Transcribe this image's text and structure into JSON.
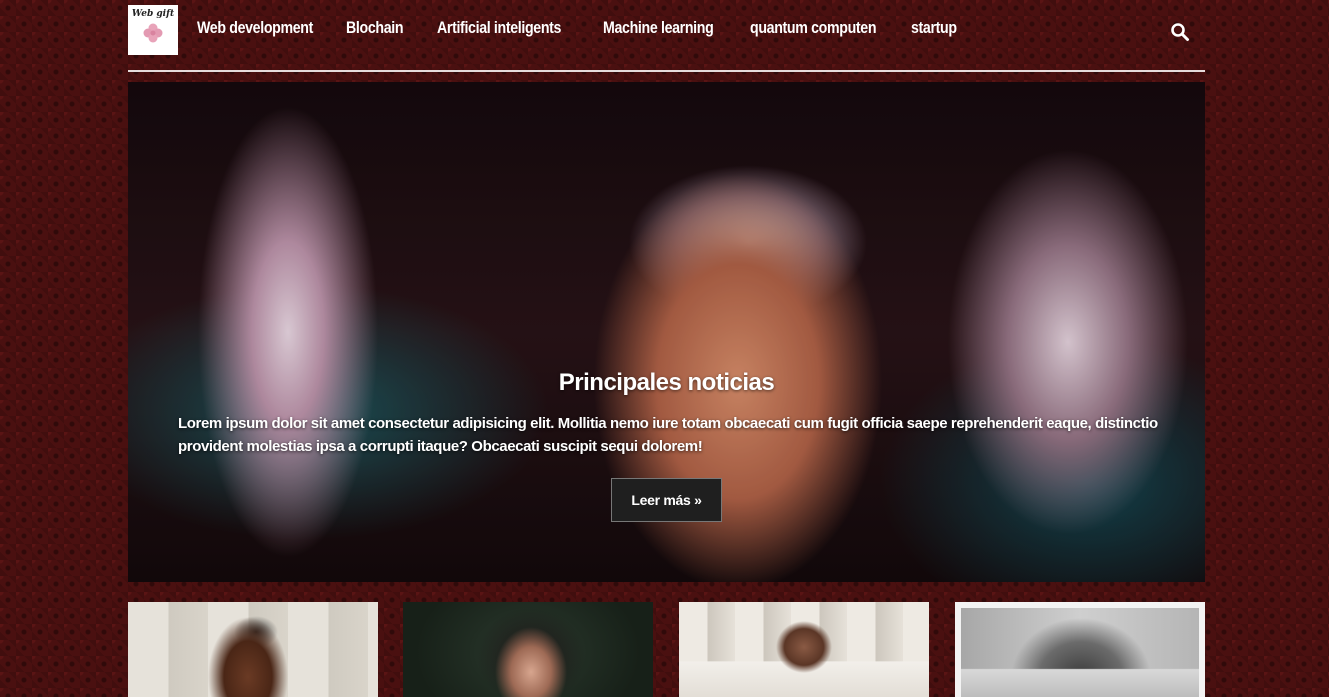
{
  "logo": {
    "text": "Web gift",
    "icon": "flower-logo-icon"
  },
  "nav": {
    "items": [
      {
        "label": "Web development"
      },
      {
        "label": "Blochain"
      },
      {
        "label": "Artificial inteligents"
      },
      {
        "label": "Machine learning"
      },
      {
        "label": "quantum computen"
      },
      {
        "label": "startup"
      }
    ],
    "search_icon": "search-icon"
  },
  "hero": {
    "title": "Principales noticias",
    "text": "Lorem ipsum dolor sit amet consectetur adipisicing elit. Mollitia nemo iure totam obcaecati cum fugit officia saepe reprehenderit eaque, distinctio provident molestias ipsa a corrupti itaque? Obcaecati suscipit sequi dolorem!",
    "button_label": "Leer más »"
  },
  "colors": {
    "background": "#4a1010",
    "nav_divider": "#e6dcdc",
    "button_bg": "#1f1f1f",
    "text": "#ffffff"
  }
}
